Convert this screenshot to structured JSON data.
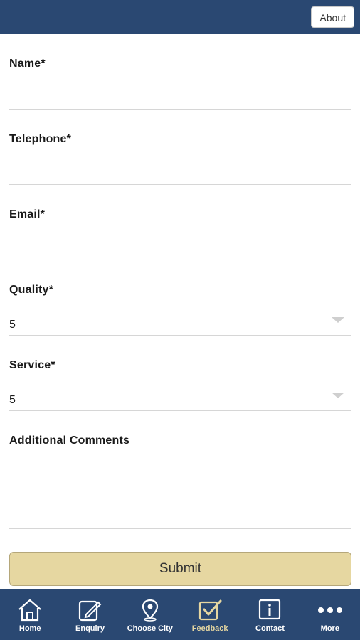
{
  "header": {
    "about_label": "About"
  },
  "form": {
    "name_label": "Name*",
    "telephone_label": "Telephone*",
    "email_label": "Email*",
    "quality_label": "Quality*",
    "quality_value": "5",
    "service_label": "Service*",
    "service_value": "5",
    "comments_label": "Additional Comments",
    "submit_label": "Submit"
  },
  "tabs": [
    {
      "label": "Home",
      "icon": "home-icon"
    },
    {
      "label": "Enquiry",
      "icon": "edit-icon"
    },
    {
      "label": "Choose City",
      "icon": "location-pin-icon"
    },
    {
      "label": "Feedback",
      "icon": "checkbox-icon",
      "active": true
    },
    {
      "label": "Contact",
      "icon": "info-icon"
    },
    {
      "label": "More",
      "icon": "more-icon"
    }
  ],
  "colors": {
    "brand": "#2a4872",
    "accent": "#e6d7a1"
  }
}
